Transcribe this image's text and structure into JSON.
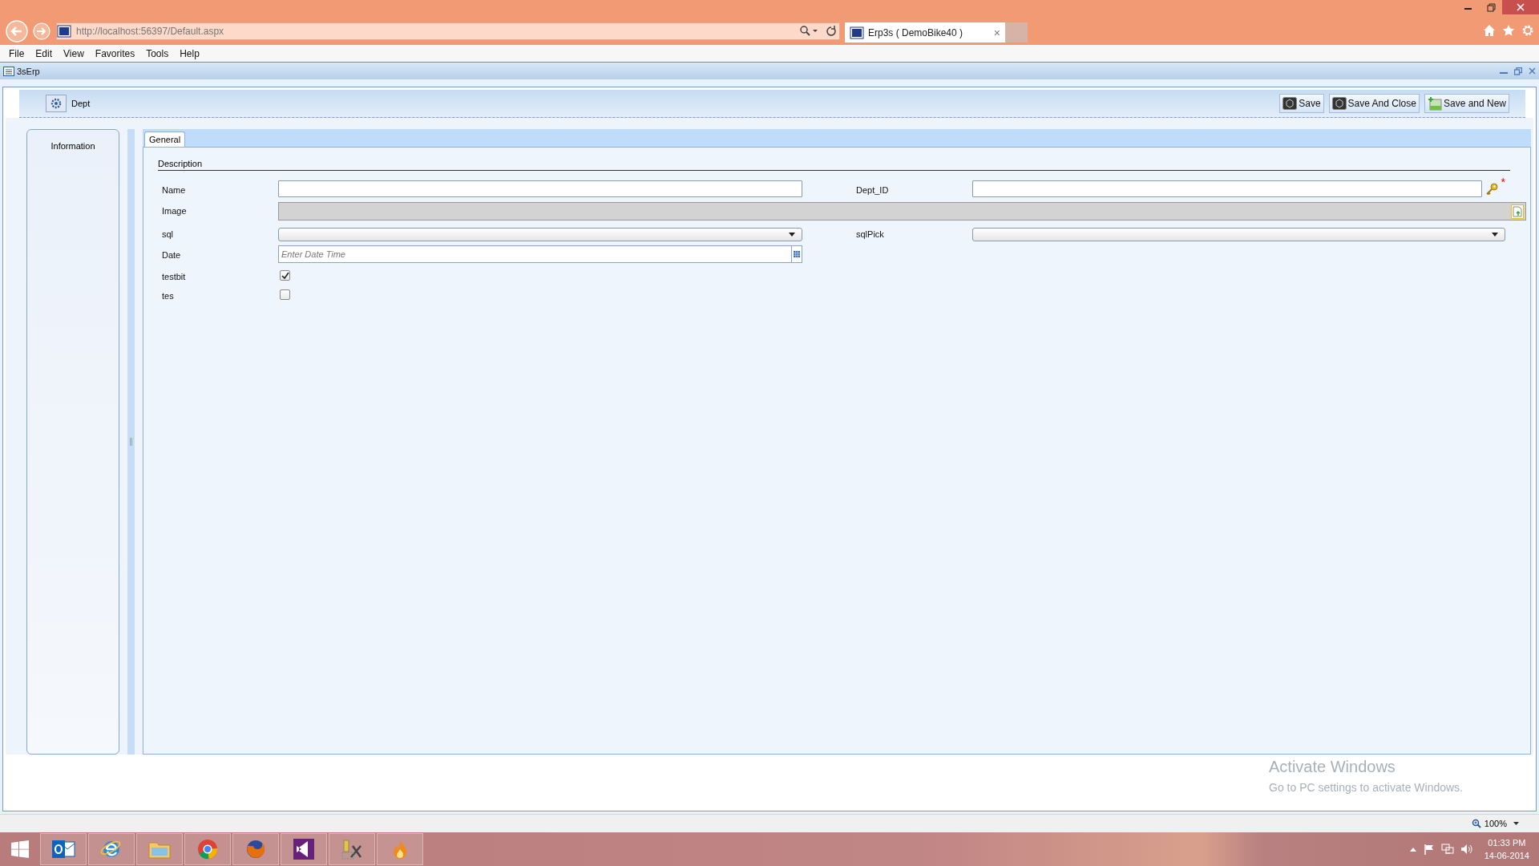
{
  "browser": {
    "address": "http://localhost:56397/Default.aspx",
    "tab_title": "Erp3s ( DemoBike40 )",
    "tab_close": "×"
  },
  "menu": [
    "File",
    "Edit",
    "View",
    "Favorites",
    "Tools",
    "Help"
  ],
  "app": {
    "title": "3sErp"
  },
  "form": {
    "title": "Dept",
    "buttons": [
      {
        "label": "Save",
        "kind": "save"
      },
      {
        "label": "Save And Close",
        "kind": "save"
      },
      {
        "label": "Save and New",
        "kind": "new"
      }
    ]
  },
  "sidebar": {
    "label": "Information"
  },
  "tabs": [
    {
      "label": "General",
      "selected": true
    }
  ],
  "section": "Description",
  "rows": [
    {
      "left": {
        "label": "Name",
        "kind": "text"
      },
      "right": {
        "label": "Dept_ID",
        "kind": "lookup",
        "required_mark": "*"
      }
    },
    {
      "left": {
        "label": "Image",
        "kind": "image"
      }
    },
    {
      "left": {
        "label": "sql",
        "kind": "select"
      },
      "right": {
        "label": "sqlPick",
        "kind": "select"
      }
    },
    {
      "left": {
        "label": "Date",
        "kind": "date",
        "placeholder": "Enter Date Time"
      }
    },
    {
      "left": {
        "label": "testbit",
        "kind": "checkbox",
        "checked": true
      }
    },
    {
      "left": {
        "label": "tes",
        "kind": "checkbox",
        "checked": false
      }
    }
  ],
  "activation": {
    "title": "Activate Windows",
    "subtitle": "Go to PC settings to activate Windows."
  },
  "status_bar": {
    "zoom": "100%"
  },
  "taskbar": {
    "apps": [
      {
        "kind": "mail"
      },
      {
        "kind": "ie"
      },
      {
        "kind": "folder"
      },
      {
        "kind": "chrome"
      },
      {
        "kind": "firefox"
      },
      {
        "kind": "vs"
      },
      {
        "kind": "tools"
      },
      {
        "kind": "flame"
      }
    ],
    "time": "01:33 PM",
    "date": "14-06-2014"
  }
}
